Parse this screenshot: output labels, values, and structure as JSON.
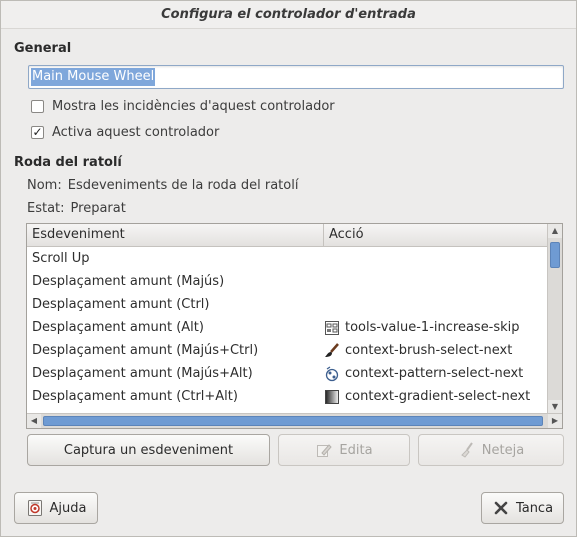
{
  "window": {
    "title": "Configura el controlador d'entrada"
  },
  "general": {
    "heading": "General",
    "name_value": "Main Mouse Wheel",
    "show_events_label": "Mostra les incidències d'aquest controlador",
    "show_events_checked": false,
    "enable_label": "Activa aquest controlador",
    "enable_checked": true
  },
  "wheel": {
    "heading": "Roda del ratolí",
    "name_key": "Nom:",
    "name_val": "Esdeveniments de la roda del ratolí",
    "state_key": "Estat:",
    "state_val": "Preparat"
  },
  "table": {
    "col_event": "Esdeveniment",
    "col_action": "Acció",
    "rows": [
      {
        "event": "Scroll Up",
        "action": "",
        "icon": ""
      },
      {
        "event": "Desplaçament amunt (Majús)",
        "action": "",
        "icon": ""
      },
      {
        "event": "Desplaçament amunt (Ctrl)",
        "action": "",
        "icon": ""
      },
      {
        "event": "Desplaçament amunt (Alt)",
        "action": "tools-value-1-increase-skip",
        "icon": "tool-options-icon"
      },
      {
        "event": "Desplaçament amunt (Majús+Ctrl)",
        "action": "context-brush-select-next",
        "icon": "brush-icon"
      },
      {
        "event": "Desplaçament amunt (Majús+Alt)",
        "action": "context-pattern-select-next",
        "icon": "pattern-icon"
      },
      {
        "event": "Desplaçament amunt (Ctrl+Alt)",
        "action": "context-gradient-select-next",
        "icon": "gradient-icon"
      }
    ]
  },
  "buttons": {
    "capture": "Captura un esdeveniment",
    "edit": "Edita",
    "clear": "Neteja",
    "help": "Ajuda",
    "close": "Tanca"
  }
}
